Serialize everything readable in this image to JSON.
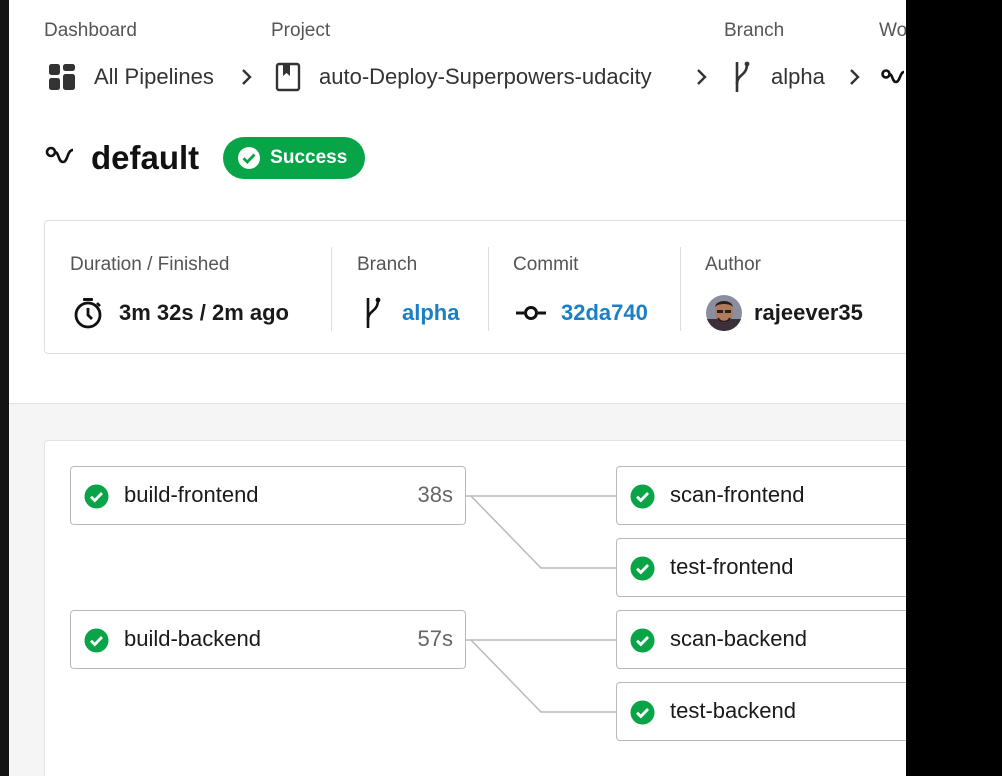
{
  "breadcrumb": {
    "labels": {
      "dashboard": "Dashboard",
      "project": "Project",
      "branch": "Branch",
      "workflow": "Wo"
    },
    "items": {
      "pipelines": {
        "label": "All Pipelines",
        "icon": "grid-icon"
      },
      "project": {
        "label": "auto-Deploy-Superpowers-udacity",
        "icon": "bookmark-icon"
      },
      "branch": {
        "label": "alpha",
        "icon": "branch-icon"
      },
      "workflow": {
        "icon": "workflow-icon"
      }
    }
  },
  "workflow": {
    "title": "default",
    "status": "Success",
    "status_color": "#07a547"
  },
  "info": {
    "duration": {
      "label": "Duration / Finished",
      "value": "3m 32s / 2m ago",
      "icon": "timer-icon"
    },
    "branch": {
      "label": "Branch",
      "value": "alpha",
      "icon": "branch-icon"
    },
    "commit": {
      "label": "Commit",
      "value": "32da740",
      "icon": "commit-icon"
    },
    "author": {
      "label": "Author",
      "value": "rajeever35",
      "icon": "avatar"
    }
  },
  "jobs": {
    "build_frontend": {
      "name": "build-frontend",
      "duration": "38s"
    },
    "scan_frontend": {
      "name": "scan-frontend"
    },
    "test_frontend": {
      "name": "test-frontend"
    },
    "build_backend": {
      "name": "build-backend",
      "duration": "57s"
    },
    "scan_backend": {
      "name": "scan-backend"
    },
    "test_backend": {
      "name": "test-backend"
    }
  },
  "colors": {
    "success": "#07a547",
    "link": "#1a7fc4",
    "border": "#b9b9b9"
  }
}
